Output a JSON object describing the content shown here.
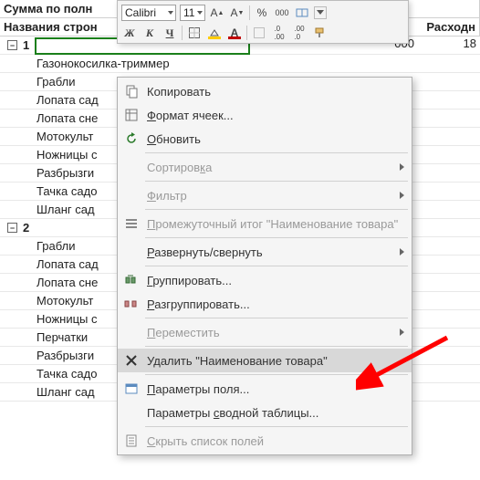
{
  "header": {
    "row1": {
      "a": "Сумма по полн",
      "b": "",
      "c": ""
    },
    "row2": {
      "a": "Названия строн",
      "b": "",
      "c": "Расходн"
    }
  },
  "partial_values": {
    "left": "000",
    "right": "18"
  },
  "groups": [
    {
      "label": "1",
      "items": [
        "Газонокосилка-триммер",
        "Грабли",
        "Лопата сад",
        "Лопата сне",
        "Мотокульт",
        "Ножницы с",
        "Разбрызги",
        "Тачка садо",
        "Шланг сад"
      ]
    },
    {
      "label": "2",
      "items": [
        "Грабли",
        "Лопата сад",
        "Лопата сне",
        "Мотокульт",
        "Ножницы с",
        "Перчатки",
        "Разбрызги",
        "Тачка садо",
        "Шланг сад"
      ]
    }
  ],
  "toolbar": {
    "font_name": "Calibri",
    "font_size": "11"
  },
  "menu": [
    {
      "icon": "copy",
      "label": "Копировать",
      "type": "item"
    },
    {
      "icon": "format",
      "label": "Формат ячеек...",
      "type": "item",
      "underline": "Ф"
    },
    {
      "icon": "refresh",
      "label": "Обновить",
      "type": "item",
      "underline": "О"
    },
    {
      "type": "sep"
    },
    {
      "icon": "",
      "label": "Сортировка",
      "type": "sub",
      "disabled": true,
      "underline": "к"
    },
    {
      "type": "sep"
    },
    {
      "icon": "",
      "label": "Фильтр",
      "type": "sub",
      "disabled": true,
      "underline": "Ф"
    },
    {
      "type": "sep"
    },
    {
      "icon": "subtotal",
      "label": "Промежуточный итог \"Наименование товара\"",
      "type": "item",
      "disabled": true,
      "underline": "П"
    },
    {
      "type": "sep"
    },
    {
      "icon": "",
      "label": "Развернуть/свернуть",
      "type": "sub",
      "underline": "Р"
    },
    {
      "type": "sep"
    },
    {
      "icon": "group",
      "label": "Группировать...",
      "type": "item",
      "underline": "Г"
    },
    {
      "icon": "ungroup",
      "label": "Разгруппировать...",
      "type": "item",
      "underline": "Р"
    },
    {
      "type": "sep"
    },
    {
      "icon": "",
      "label": "Переместить",
      "type": "sub",
      "disabled": true,
      "underline": "П"
    },
    {
      "type": "sep"
    },
    {
      "icon": "delete",
      "label": "Удалить \"Наименование товара\"",
      "type": "item",
      "highlight": true
    },
    {
      "type": "sep"
    },
    {
      "icon": "field",
      "label": "Параметры поля...",
      "type": "item",
      "underline": "П"
    },
    {
      "icon": "",
      "label": "Параметры сводной таблицы...",
      "type": "item",
      "underline": "с"
    },
    {
      "type": "sep"
    },
    {
      "icon": "list",
      "label": "Скрыть список полей",
      "type": "item",
      "disabled": true,
      "underline": "С"
    }
  ]
}
